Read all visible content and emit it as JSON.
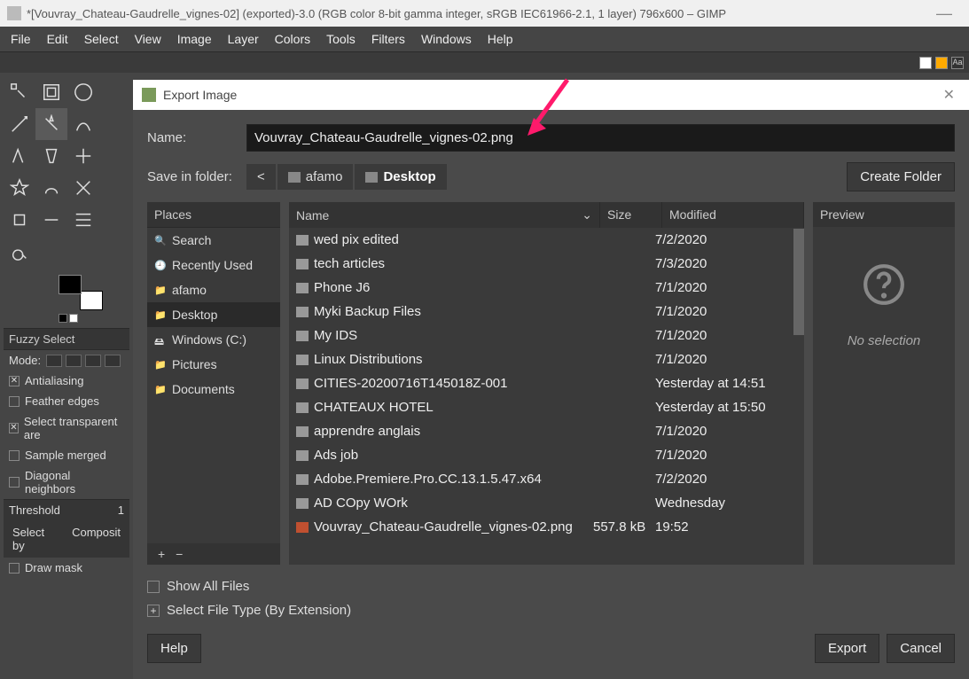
{
  "window": {
    "title": "*[Vouvray_Chateau-Gaudrelle_vignes-02] (exported)-3.0 (RGB color 8-bit gamma integer, sRGB IEC61966-2.1, 1 layer) 796x600 – GIMP"
  },
  "menubar": [
    "File",
    "Edit",
    "Select",
    "View",
    "Image",
    "Layer",
    "Colors",
    "Tools",
    "Filters",
    "Windows",
    "Help"
  ],
  "tool_options": {
    "title": "Fuzzy Select",
    "mode_label": "Mode:",
    "antialiasing": "Antialiasing",
    "feather": "Feather edges",
    "transparent": "Select transparent are",
    "sample_merged": "Sample merged",
    "diagonal": "Diagonal neighbors",
    "threshold_label": "Threshold",
    "threshold_value": "1",
    "selectby": "Select by",
    "composite": "Composit",
    "drawmask": "Draw mask"
  },
  "dialog": {
    "title": "Export Image",
    "name_label": "Name:",
    "name_value": "Vouvray_Chateau-Gaudrelle_vignes-02.png",
    "savein_label": "Save in folder:",
    "crumb_back": "<",
    "crumb_user": "afamo",
    "crumb_desktop": "Desktop",
    "create_folder": "Create Folder",
    "places_head": "Places",
    "places": [
      {
        "label": "Search",
        "icon": "search"
      },
      {
        "label": "Recently Used",
        "icon": "clock"
      },
      {
        "label": "afamo",
        "icon": "folder"
      },
      {
        "label": "Desktop",
        "icon": "folder",
        "active": true
      },
      {
        "label": "Windows (C:)",
        "icon": "disk"
      },
      {
        "label": "Pictures",
        "icon": "folder"
      },
      {
        "label": "Documents",
        "icon": "folder"
      }
    ],
    "name_col": "Name",
    "size_col": "Size",
    "mod_col": "Modified",
    "files": [
      {
        "name": "wed pix edited",
        "size": "",
        "mod": "7/2/2020",
        "type": "folder"
      },
      {
        "name": "tech articles",
        "size": "",
        "mod": "7/3/2020",
        "type": "folder"
      },
      {
        "name": "Phone J6",
        "size": "",
        "mod": "7/1/2020",
        "type": "folder"
      },
      {
        "name": "Myki Backup Files",
        "size": "",
        "mod": "7/1/2020",
        "type": "folder"
      },
      {
        "name": "My IDS",
        "size": "",
        "mod": "7/1/2020",
        "type": "folder"
      },
      {
        "name": "Linux Distributions",
        "size": "",
        "mod": "7/1/2020",
        "type": "folder"
      },
      {
        "name": "CITIES-20200716T145018Z-001",
        "size": "",
        "mod": "Yesterday at 14:51",
        "type": "folder"
      },
      {
        "name": "CHATEAUX HOTEL",
        "size": "",
        "mod": "Yesterday at 15:50",
        "type": "folder"
      },
      {
        "name": "apprendre anglais",
        "size": "",
        "mod": "7/1/2020",
        "type": "folder"
      },
      {
        "name": "Ads job",
        "size": "",
        "mod": "7/1/2020",
        "type": "folder"
      },
      {
        "name": "Adobe.Premiere.Pro.CC.13.1.5.47.x64",
        "size": "",
        "mod": "7/2/2020",
        "type": "folder"
      },
      {
        "name": "AD COpy WOrk",
        "size": "",
        "mod": "Wednesday",
        "type": "folder"
      },
      {
        "name": "Vouvray_Chateau-Gaudrelle_vignes-02.png",
        "size": "557.8 kB",
        "mod": "19:52",
        "type": "file"
      }
    ],
    "preview_head": "Preview",
    "preview_text": "No selection",
    "show_all": "Show All Files",
    "select_type": "Select File Type (By Extension)",
    "help": "Help",
    "export": "Export",
    "cancel": "Cancel",
    "places_add": "+",
    "places_remove": "−"
  }
}
